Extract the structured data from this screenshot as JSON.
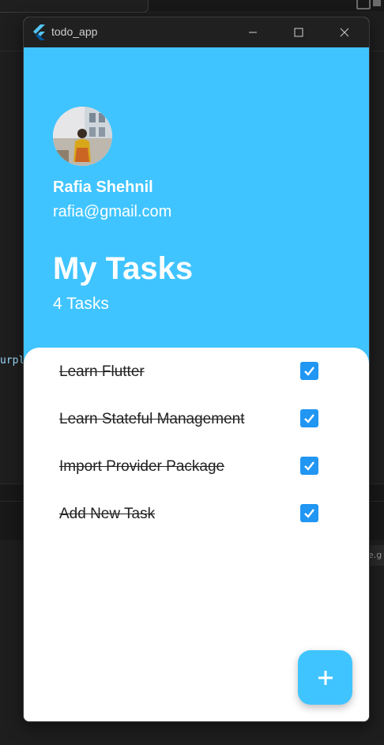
{
  "background": {
    "code_fragment": "urpl",
    "right_fragment": "e.g"
  },
  "window": {
    "title": "todo_app"
  },
  "header": {
    "user_name": "Rafia Shehnil",
    "user_email": "rafia@gmail.com",
    "title": "My Tasks",
    "task_count": "4 Tasks"
  },
  "tasks": [
    {
      "label": "Learn Flutter",
      "done": true
    },
    {
      "label": "Learn Stateful Management",
      "done": true
    },
    {
      "label": "Import Provider Package",
      "done": true
    },
    {
      "label": "Add New Task",
      "done": true
    }
  ],
  "colors": {
    "accent": "#40c4ff",
    "checkbox": "#2196f3"
  },
  "icons": {
    "app_logo": "flutter-logo-icon",
    "fab": "plus-icon",
    "checkbox": "check-icon"
  }
}
